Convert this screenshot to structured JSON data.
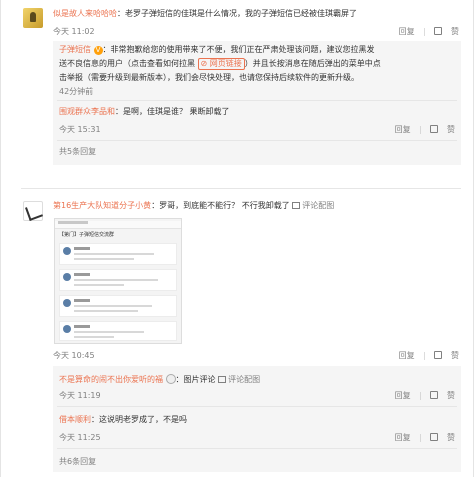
{
  "comment1": {
    "username": "似是故人来哈哈哈",
    "text": "：老罗子弹短信的佳琪是什么情况，我的子弹短信已经被佳琪霸屏了",
    "time": "今天 11:02",
    "actions": [
      "回复",
      "赞"
    ],
    "reply_official": {
      "username": "子弹短信",
      "verified_badge": "V",
      "text_lines": [
        "：非常抱歉给您的使用带来了不便，我们正在严肃处理该问题，建议您拉黑发",
        "送不良信息的用户（点击查看如何拉黑",
        "）并且长按消息在随后弹出的菜单中点",
        "击举报（需要升级到最新版本），我们会尽快处理，也请您保持后续软件的更新升级。"
      ],
      "link_label": "网页链接",
      "time": "42分钟前"
    },
    "reply2": {
      "username": "围观群众李品和",
      "text": "：是啊，佳琪是谁？ 果断卸载了",
      "time": "今天 15:31",
      "actions": [
        "回复",
        "赞"
      ]
    },
    "more_replies": "共5条回复"
  },
  "comment2": {
    "username": "第16生产大队知道分子小黄",
    "text": "：罗哥，到底能不能行？ 不行我卸载了",
    "comment_image_label": "评论配图",
    "screenshot_title": "【第门】子弹短信交流群",
    "time": "今天 10:45",
    "actions": [
      "回复",
      "赞"
    ],
    "reply1": {
      "username": "不是算命的闹不出你爱听的福",
      "text": "：图片评论",
      "comment_image_label": "评论配图",
      "time": "今天 11:19",
      "actions": [
        "回复",
        "赞"
      ]
    },
    "reply2": {
      "username": "借本顺利",
      "text": "：这说明老罗成了，不是吗",
      "time": "今天 11:25",
      "actions": [
        "回复",
        "赞"
      ]
    },
    "more_replies": "共6条回复"
  },
  "icons": [
    "avatar-gold",
    "avatar-sketch",
    "thumb-up-icon",
    "link-icon",
    "picture-icon",
    "emoji-icon"
  ]
}
